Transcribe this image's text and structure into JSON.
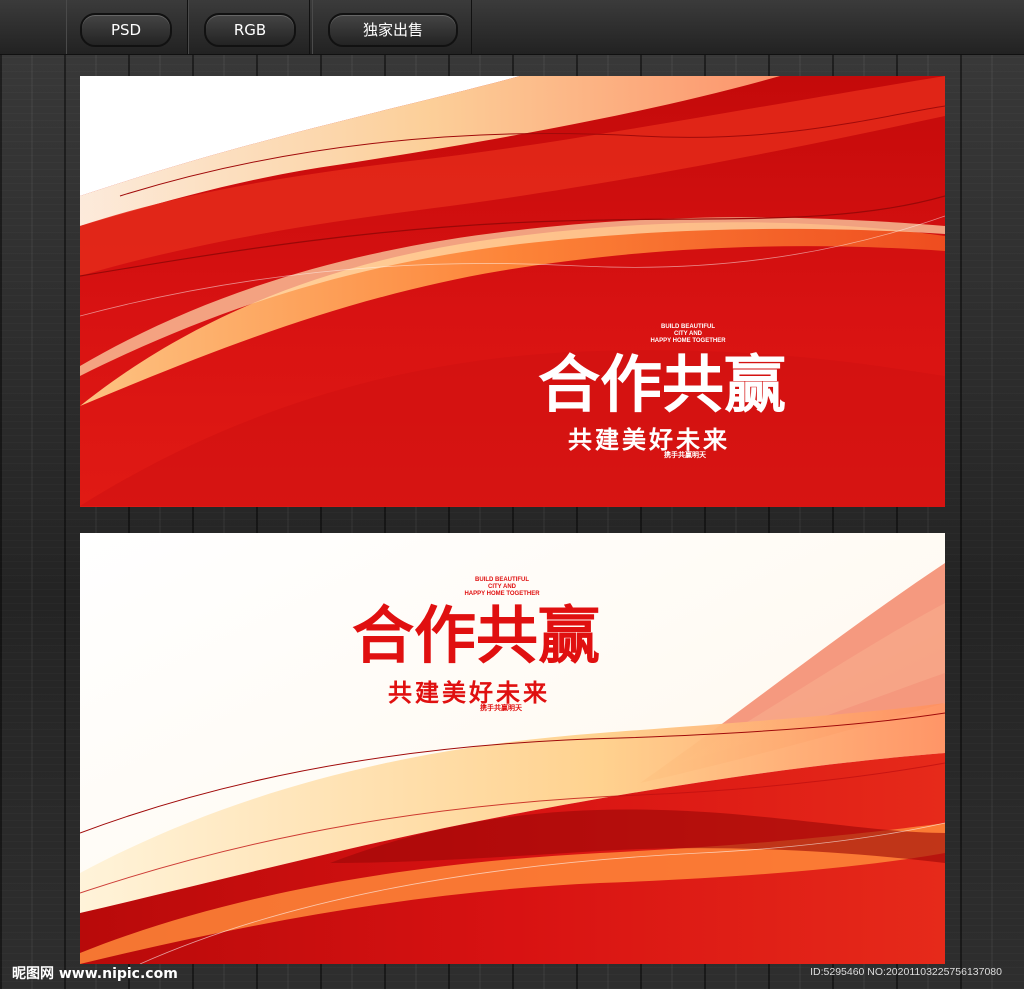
{
  "toolbar": {
    "format_label": "PSD",
    "color_mode_label": "RGB",
    "license_label": "独家出售"
  },
  "banner_red": {
    "title": "合作共赢",
    "subtitle": "共建美好未来",
    "english_lines": [
      "BUILD BEAUTIFUL",
      "CITY AND",
      "HAPPY HOME TOGETHER"
    ],
    "handwritten": "携手共赢明天",
    "colors": {
      "primary": "#d81010",
      "text": "#ffffff"
    }
  },
  "banner_white": {
    "title": "合作共赢",
    "subtitle": "共建美好未来",
    "english_lines": [
      "BUILD BEAUTIFUL",
      "CITY AND",
      "HAPPY HOME TOGETHER"
    ],
    "handwritten": "携手共赢明天",
    "colors": {
      "primary": "#e01010",
      "background": "#ffffff"
    }
  },
  "footer": {
    "site": "昵图网 www.nipic.com",
    "id_text": "ID:5295460 NO:20201103225756137080"
  }
}
